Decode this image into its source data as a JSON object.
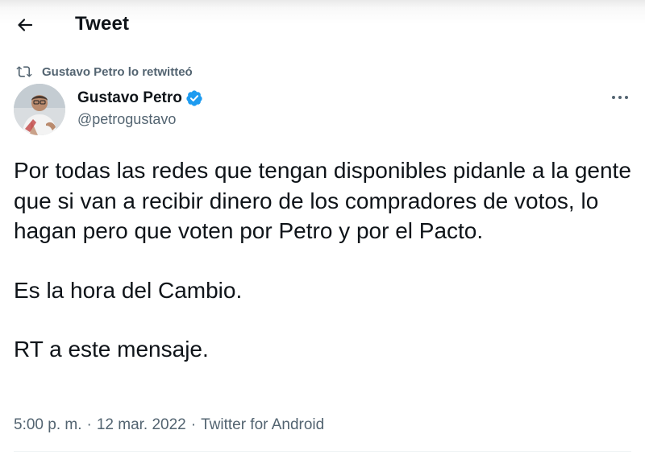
{
  "header": {
    "title": "Tweet",
    "back_icon": "arrow-left-icon"
  },
  "retweet": {
    "icon": "retweet-icon",
    "text": "Gustavo Petro lo retwitteó"
  },
  "author": {
    "name": "Gustavo Petro",
    "handle": "@petrogustavo",
    "verified": true,
    "verified_color": "#1d9bf0",
    "avatar_icon": "user-avatar"
  },
  "more_icon": "more-horizontal-icon",
  "tweet": {
    "paragraphs": [
      "Por todas las redes que tengan disponibles pidanle a la gente que si van a recibir dinero de los compradores de votos, lo hagan pero que voten por Petro y por el Pacto.",
      "Es la hora del Cambio.",
      "RT a este mensaje."
    ],
    "time": "5:00 p. m.",
    "separator": "·",
    "date": "12 mar. 2022",
    "source": "Twitter for Android"
  },
  "colors": {
    "text": "#0f1419",
    "secondary": "#536471"
  }
}
